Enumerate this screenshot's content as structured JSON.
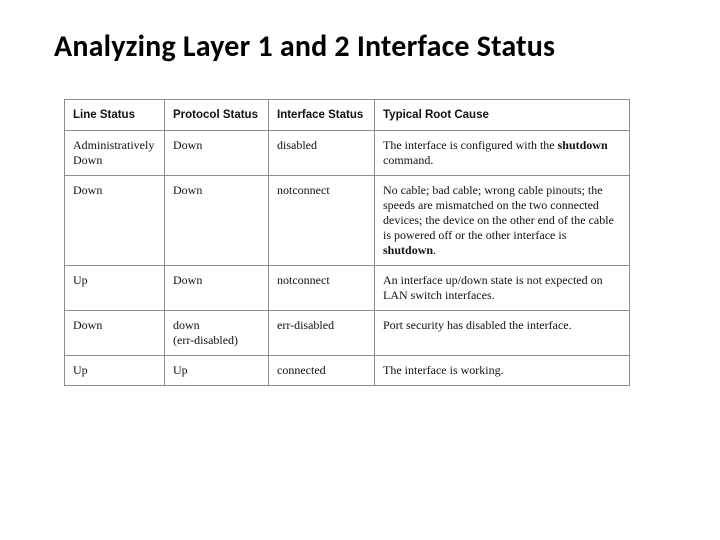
{
  "title": "Analyzing Layer 1 and 2 Interface Status",
  "table": {
    "headers": {
      "line_status": "Line Status",
      "protocol_status": "Protocol Status",
      "interface_status": "Interface Status",
      "root_cause": "Typical Root Cause"
    },
    "rows": [
      {
        "line_status_l1": "Administratively",
        "line_status_l2": "Down",
        "protocol_status": "Down",
        "interface_status": "disabled",
        "cause_pre": "The interface is configured with the ",
        "cause_b1": "shutdown",
        "cause_post": " command."
      },
      {
        "line_status_l1": "Down",
        "line_status_l2": "",
        "protocol_status": "Down",
        "interface_status": "notconnect",
        "cause_pre": "No cable; bad cable; wrong cable pinouts; the speeds are mismatched on the two connected devices; the device on the other end of the cable is powered off or the other interface is ",
        "cause_b1": "shutdown",
        "cause_post": "."
      },
      {
        "line_status_l1": "Up",
        "line_status_l2": "",
        "protocol_status": "Down",
        "interface_status": "notconnect",
        "cause_pre": "An interface up/down state is not expected on LAN switch interfaces.",
        "cause_b1": "",
        "cause_post": ""
      },
      {
        "line_status_l1": "Down",
        "line_status_l2": "",
        "protocol_status_l1": "down",
        "protocol_status_l2": "(err-disabled)",
        "interface_status": "err-disabled",
        "cause_pre": "Port security has disabled the interface.",
        "cause_b1": "",
        "cause_post": ""
      },
      {
        "line_status_l1": "Up",
        "line_status_l2": "",
        "protocol_status": "Up",
        "interface_status": "connected",
        "cause_pre": "The interface is working.",
        "cause_b1": "",
        "cause_post": ""
      }
    ]
  }
}
